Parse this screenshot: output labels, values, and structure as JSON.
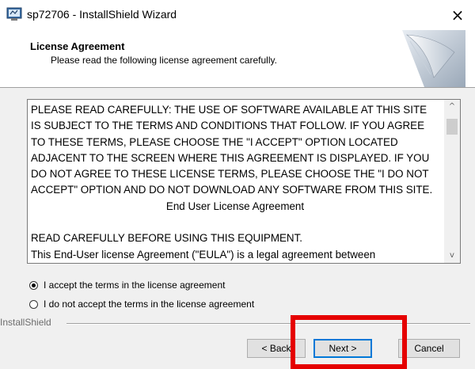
{
  "window": {
    "title": "sp72706 - InstallShield Wizard",
    "close_glyph": "×"
  },
  "header": {
    "title": "License Agreement",
    "subtitle": "Please read the following license agreement carefully."
  },
  "license": {
    "paragraph1": "PLEASE READ CAREFULLY: THE USE OF SOFTWARE AVAILABLE AT THIS SITE IS SUBJECT TO THE TERMS AND CONDITIONS THAT FOLLOW. IF YOU AGREE TO THESE TERMS, PLEASE CHOOSE THE \"I ACCEPT\" OPTION LOCATED ADJACENT TO THE SCREEN WHERE THIS AGREEMENT IS DISPLAYED. IF YOU DO NOT AGREE TO THESE LICENSE TERMS, PLEASE CHOOSE THE \"I DO NOT ACCEPT\" OPTION AND DO NOT DOWNLOAD ANY SOFTWARE FROM THIS SITE.",
    "heading": "End User License Agreement",
    "paragraph2": "READ CAREFULLY BEFORE USING THIS EQUIPMENT.",
    "paragraph3": "This End-User license Agreement (\"EULA\") is a legal agreement between"
  },
  "scrollbar": {
    "up_glyph": "^",
    "down_glyph": "v"
  },
  "options": {
    "accept_label": "I accept the terms in the license agreement",
    "decline_label": "I do not accept the terms in the license agreement",
    "selected": "accept"
  },
  "footer": {
    "brand": "InstallShield",
    "back_label": "< Back",
    "next_label": "Next >",
    "cancel_label": "Cancel"
  },
  "colors": {
    "highlight": "#e50000",
    "focus": "#0078d7"
  }
}
